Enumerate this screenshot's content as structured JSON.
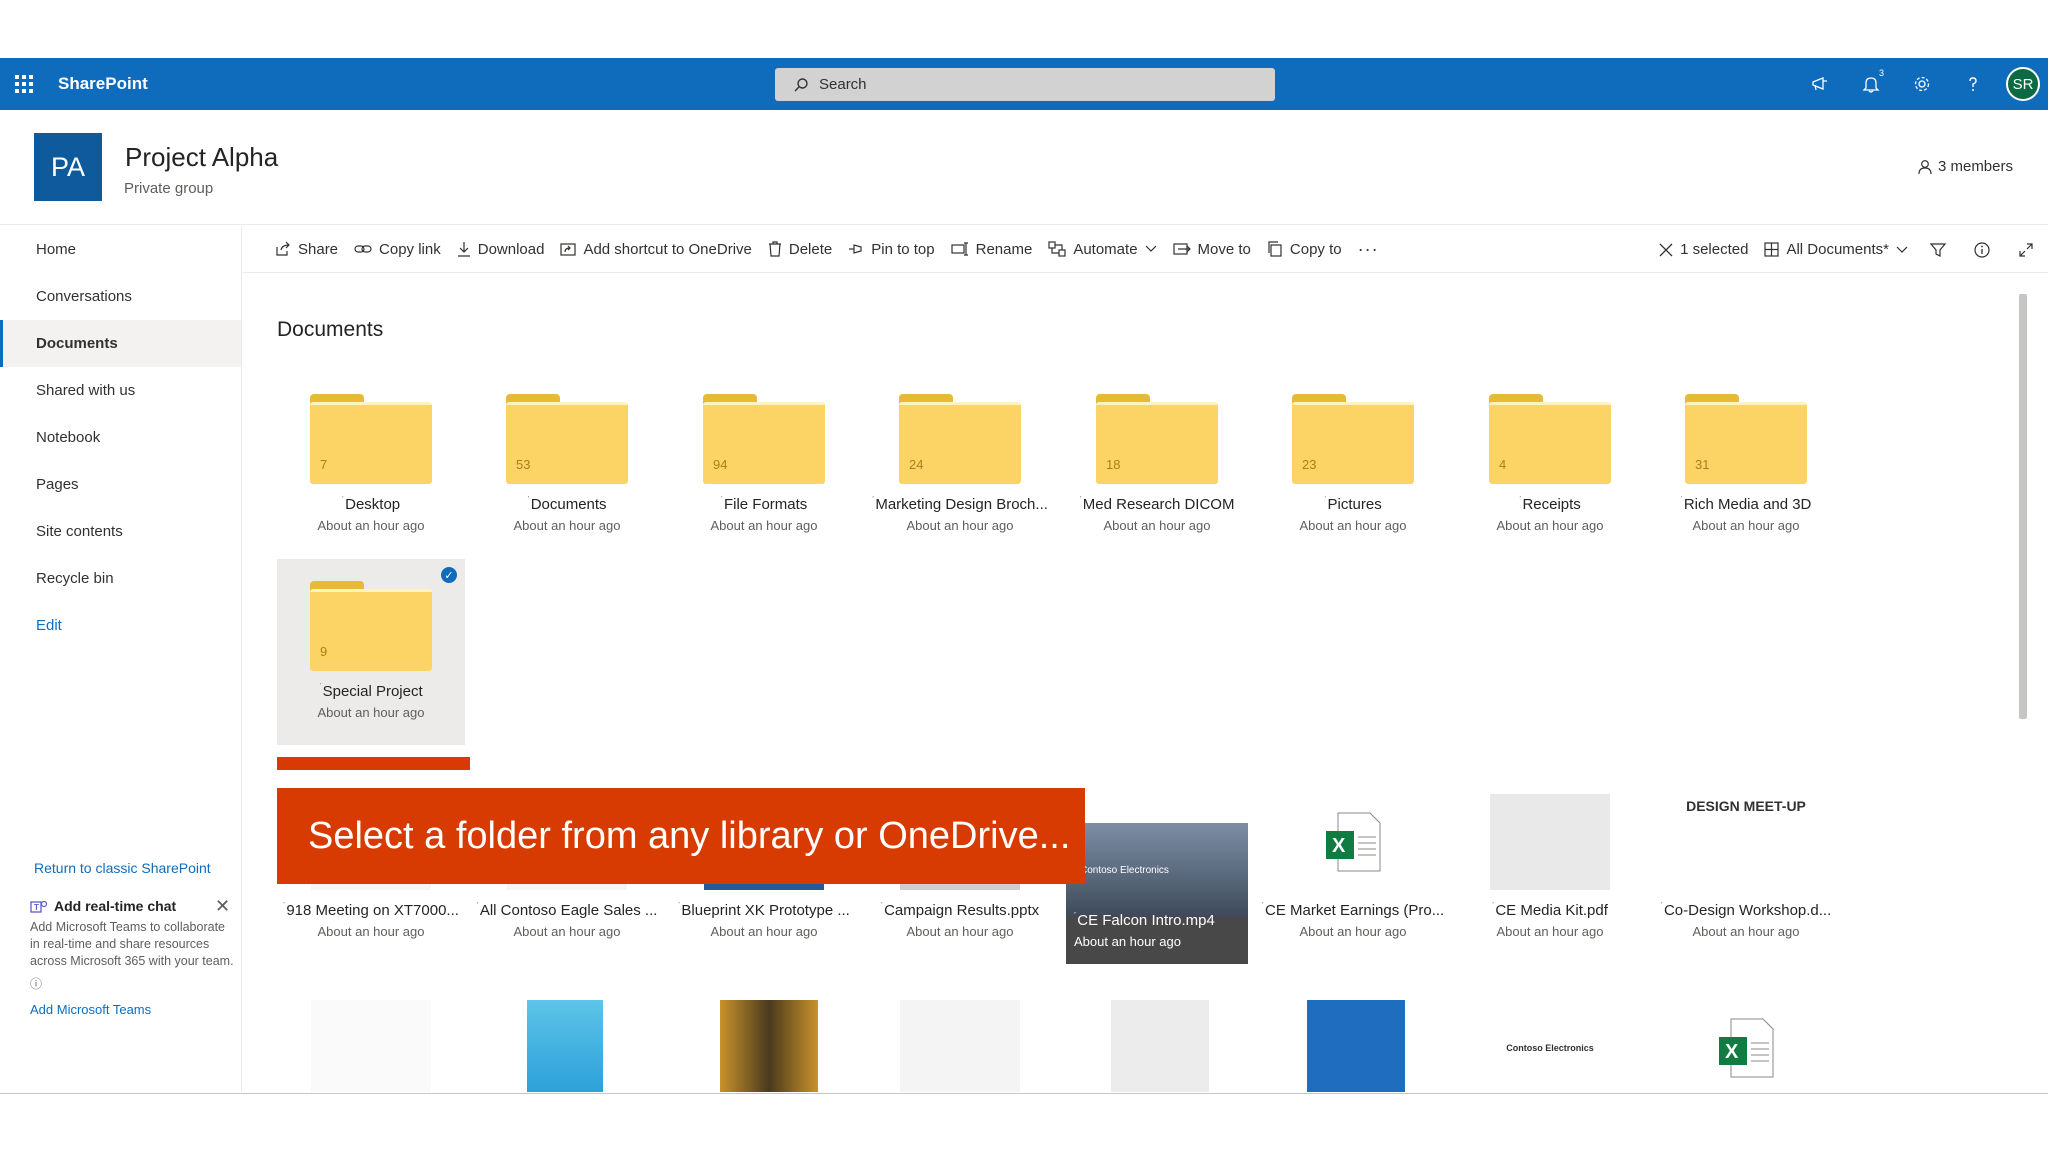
{
  "suite": {
    "brand": "SharePoint",
    "search_placeholder": "Search",
    "notification_count": "3",
    "avatar": "SR"
  },
  "site": {
    "logo": "PA",
    "title": "Project Alpha",
    "subtitle": "Private group",
    "members": "3 members"
  },
  "nav": {
    "items": [
      "Home",
      "Conversations",
      "Documents",
      "Shared with us",
      "Notebook",
      "Pages",
      "Site contents",
      "Recycle bin",
      "Edit"
    ],
    "active": "Documents",
    "classic_link": "Return to classic SharePoint",
    "chat": {
      "title": "Add real-time chat",
      "body": "Add Microsoft Teams to collaborate in real-time and share resources across Microsoft 365 with your team.",
      "link": "Add Microsoft Teams"
    }
  },
  "commands": {
    "share": "Share",
    "copy_link": "Copy link",
    "download": "Download",
    "add_shortcut": "Add shortcut to OneDrive",
    "delete": "Delete",
    "pin": "Pin to top",
    "rename": "Rename",
    "automate": "Automate",
    "move": "Move to",
    "copy": "Copy to",
    "more": "···",
    "selected": "1 selected",
    "view": "All Documents*"
  },
  "library": {
    "heading": "Documents",
    "folders": [
      {
        "name": "Desktop",
        "count": "7",
        "meta": "About an hour ago"
      },
      {
        "name": "Documents",
        "count": "53",
        "meta": "About an hour ago"
      },
      {
        "name": "File Formats",
        "count": "94",
        "meta": "About an hour ago"
      },
      {
        "name": "Marketing Design Broch...",
        "count": "24",
        "meta": "About an hour ago"
      },
      {
        "name": "Med Research DICOM",
        "count": "18",
        "meta": "About an hour ago"
      },
      {
        "name": "Pictures",
        "count": "23",
        "meta": "About an hour ago"
      },
      {
        "name": "Receipts",
        "count": "4",
        "meta": "About an hour ago"
      },
      {
        "name": "Rich Media and 3D",
        "count": "31",
        "meta": "About an hour ago"
      },
      {
        "name": "Special Project",
        "count": "9",
        "meta": "About an hour ago"
      }
    ],
    "files": [
      {
        "name": "918 Meeting on XT7000...",
        "meta": "About an hour ago"
      },
      {
        "name": "All Contoso Eagle Sales ...",
        "meta": "About an hour ago"
      },
      {
        "name": "Blueprint XK Prototype ...",
        "meta": "About an hour ago"
      },
      {
        "name": "Campaign Results.pptx",
        "meta": "About an hour ago"
      },
      {
        "name": "CE Falcon Intro.mp4",
        "meta": "About an hour ago",
        "overlay": "Contoso Electronics"
      },
      {
        "name": "CE Market Earnings (Pro...",
        "meta": "About an hour ago"
      },
      {
        "name": "CE Media Kit.pdf",
        "meta": "About an hour ago"
      },
      {
        "name": "Co-Design Workshop.d...",
        "meta": "About an hour ago",
        "thumb_text": "DESIGN MEET-UP"
      }
    ],
    "row3_label": "Contoso Electronics"
  },
  "callout": "Select a folder from any library or OneDrive..."
}
